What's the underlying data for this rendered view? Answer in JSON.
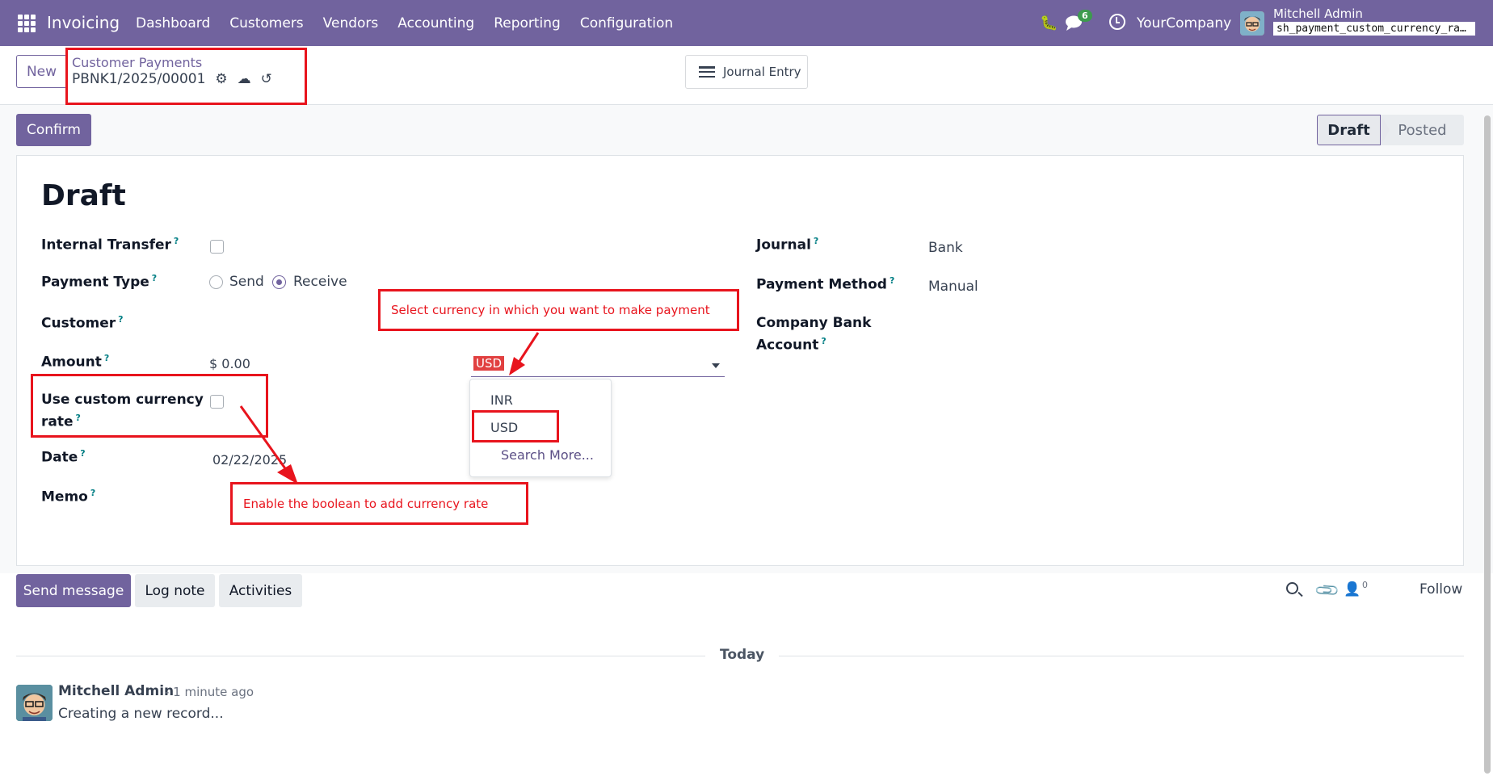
{
  "navbar": {
    "app_name": "Invoicing",
    "menu": [
      "Dashboard",
      "Customers",
      "Vendors",
      "Accounting",
      "Reporting",
      "Configuration"
    ],
    "chat_count": "6",
    "company": "YourCompany",
    "user": "Mitchell Admin",
    "db": "sh_payment_custom_currency_rate"
  },
  "control_panel": {
    "new_label": "New",
    "breadcrumb": "Customer Payments",
    "record": "PBNK1/2025/00001",
    "journal_entry_label": "Journal Entry"
  },
  "statusbar": {
    "confirm_label": "Confirm",
    "stages": [
      "Draft",
      "Posted"
    ],
    "active_stage": "Draft"
  },
  "form": {
    "title": "Draft",
    "internal_transfer_label": "Internal Transfer",
    "payment_type_label": "Payment Type",
    "payment_type_options": [
      "Send",
      "Receive"
    ],
    "payment_type_selected": "Receive",
    "customer_label": "Customer",
    "amount_label": "Amount",
    "amount_value": "$ 0.00",
    "currency_value": "USD",
    "currency_options": [
      "INR",
      "USD"
    ],
    "search_more": "Search More...",
    "custom_rate_label_line1": "Use custom currency",
    "custom_rate_label_line2": "rate",
    "date_label": "Date",
    "date_value": "02/22/2025",
    "memo_label": "Memo",
    "journal_label": "Journal",
    "journal_value": "Bank",
    "payment_method_label": "Payment Method",
    "payment_method_value": "Manual",
    "company_bank_label_line1": "Company Bank",
    "company_bank_label_line2": "Account",
    "help_mark": "?"
  },
  "annotations": {
    "currency_note": "Select currency in which you want to make payment",
    "boolean_note": "Enable the boolean to add currency rate"
  },
  "chatter": {
    "send_message": "Send message",
    "log_note": "Log note",
    "activities": "Activities",
    "followers_count": "0",
    "follow": "Follow",
    "today": "Today",
    "author": "Mitchell Admin",
    "time": "- 1 minute ago",
    "body": "Creating a new record..."
  },
  "colors": {
    "brand": "#71639e",
    "annotation": "#e8141d",
    "help": "#017e84"
  }
}
